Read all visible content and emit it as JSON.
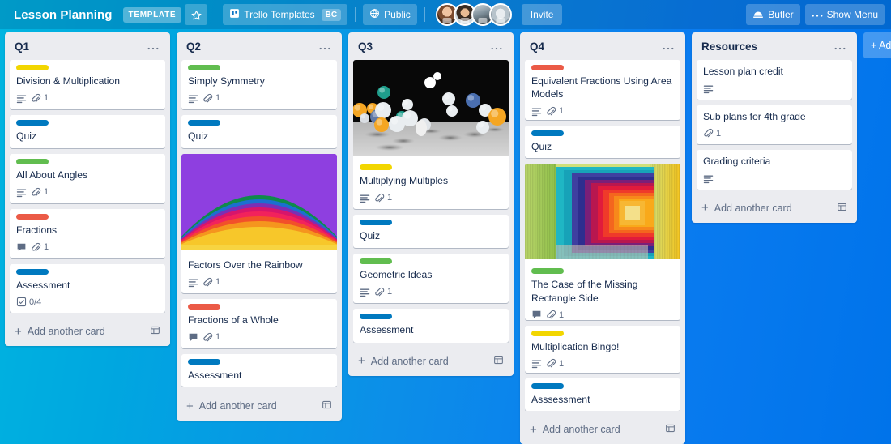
{
  "header": {
    "board_title": "Lesson Planning",
    "template_badge": "TEMPLATE",
    "star_icon": "star-icon",
    "workspace": {
      "icon": "trello-board-icon",
      "name": "Trello Templates",
      "initials_badge": "BC"
    },
    "visibility": {
      "icon": "globe-icon",
      "label": "Public"
    },
    "invite_label": "Invite",
    "butler": {
      "icon": "butler-icon",
      "label": "Butler"
    },
    "show_menu": {
      "icon": "ellipsis-icon",
      "label": "Show Menu"
    },
    "members": [
      {
        "name": "member-avatar-1"
      },
      {
        "name": "member-avatar-2"
      },
      {
        "name": "member-avatar-3"
      },
      {
        "name": "member-avatar-4"
      }
    ]
  },
  "add_list_label": "+ Add",
  "add_card_label": "Add another card",
  "colors": {
    "label_yellow": "#f2d600",
    "label_green": "#61bd4f",
    "label_blue": "#0079bf",
    "label_red": "#eb5a46",
    "list_bg": "#ebecf0",
    "card_bg": "#ffffff",
    "text": "#172b4d",
    "muted_text": "#5e6c84",
    "background_from": "#00b5e0",
    "background_to": "#0073ea"
  },
  "lists": [
    {
      "title": "Q1",
      "cards": [
        {
          "title": "Division & Multiplication",
          "label": "yellow",
          "badges": [
            {
              "type": "description"
            },
            {
              "type": "attachment",
              "count": "1"
            }
          ]
        },
        {
          "title": "Quiz",
          "label": "blue",
          "badges": []
        },
        {
          "title": "All About Angles",
          "label": "green",
          "badges": [
            {
              "type": "description"
            },
            {
              "type": "attachment",
              "count": "1"
            }
          ]
        },
        {
          "title": "Fractions",
          "label": "red",
          "badges": [
            {
              "type": "comment"
            },
            {
              "type": "attachment",
              "count": "1"
            }
          ]
        },
        {
          "title": "Assessment",
          "label": "blue",
          "badges": [
            {
              "type": "checklist",
              "count": "0/4"
            }
          ]
        }
      ]
    },
    {
      "title": "Q2",
      "cards": [
        {
          "title": "Simply Symmetry",
          "label": "green",
          "badges": [
            {
              "type": "description"
            },
            {
              "type": "attachment",
              "count": "1"
            }
          ]
        },
        {
          "title": "Quiz",
          "label": "blue",
          "badges": []
        },
        {
          "title": "Factors Over the Rainbow",
          "cover": "rainbow-arcs",
          "badges": [
            {
              "type": "description"
            },
            {
              "type": "attachment",
              "count": "1"
            }
          ]
        },
        {
          "title": "Fractions of a Whole",
          "label": "red",
          "badges": [
            {
              "type": "comment"
            },
            {
              "type": "attachment",
              "count": "1"
            }
          ]
        },
        {
          "title": "Assessment",
          "label": "blue",
          "badges": []
        }
      ]
    },
    {
      "title": "Q3",
      "cards": [
        {
          "title": "Multiplying Multiples",
          "label": "yellow",
          "cover": "floating-spheres",
          "badges": [
            {
              "type": "description"
            },
            {
              "type": "attachment",
              "count": "1"
            }
          ]
        },
        {
          "title": "Quiz",
          "label": "blue",
          "badges": []
        },
        {
          "title": "Geometric Ideas",
          "label": "green",
          "badges": [
            {
              "type": "description"
            },
            {
              "type": "attachment",
              "count": "1"
            }
          ]
        },
        {
          "title": "Assessment",
          "label": "blue",
          "badges": []
        }
      ]
    },
    {
      "title": "Q4",
      "cards": [
        {
          "title": "Equivalent Fractions Using Area Models",
          "label": "red",
          "badges": [
            {
              "type": "description"
            },
            {
              "type": "attachment",
              "count": "1"
            }
          ]
        },
        {
          "title": "Quiz",
          "label": "blue",
          "badges": []
        },
        {
          "title": "The Case of the Missing Rectangle Side",
          "label": "green",
          "cover": "color-corridor",
          "badges": [
            {
              "type": "comment"
            },
            {
              "type": "attachment",
              "count": "1"
            }
          ]
        },
        {
          "title": "Multiplication Bingo!",
          "label": "yellow",
          "badges": [
            {
              "type": "description"
            },
            {
              "type": "attachment",
              "count": "1"
            }
          ]
        },
        {
          "title": "Asssessment",
          "label": "blue",
          "badges": []
        }
      ]
    },
    {
      "title": "Resources",
      "cards": [
        {
          "title": "Lesson plan credit",
          "badges": [
            {
              "type": "description"
            }
          ]
        },
        {
          "title": "Sub plans for 4th grade",
          "badges": [
            {
              "type": "attachment",
              "count": "1"
            }
          ]
        },
        {
          "title": "Grading criteria",
          "badges": [
            {
              "type": "description"
            }
          ]
        }
      ]
    }
  ]
}
